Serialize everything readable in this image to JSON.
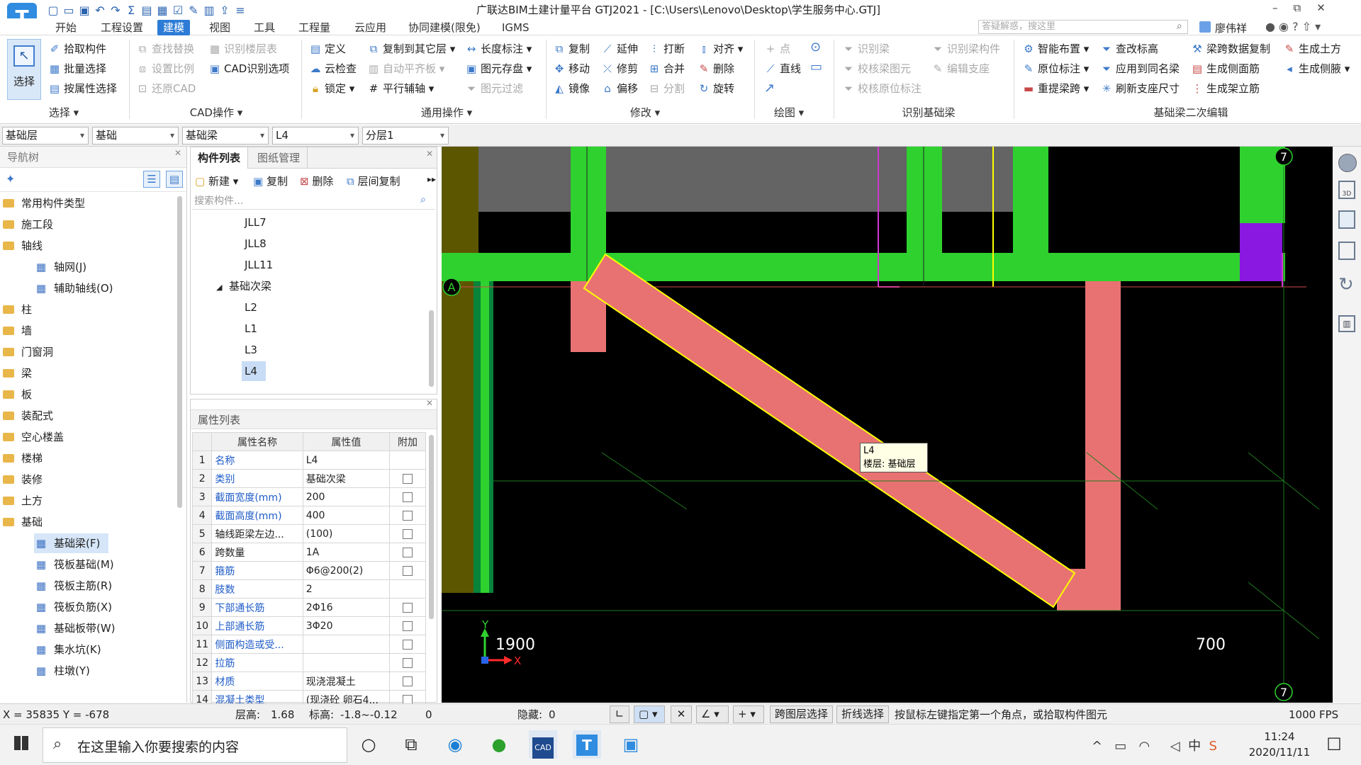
{
  "app": {
    "title": "广联达BIM土建计量平台 GTJ2021 - [C:\\Users\\Lenovo\\Desktop\\学生服务中心.GTJ]",
    "search_placeholder": "答疑解惑，搜这里",
    "user": "廖伟祥",
    "window_controls": [
      "–",
      "⧉",
      "✕"
    ]
  },
  "menu": [
    {
      "label": "开始",
      "active": false
    },
    {
      "label": "工程设置",
      "active": false
    },
    {
      "label": "建模",
      "active": true
    },
    {
      "label": "视图",
      "active": false
    },
    {
      "label": "工具",
      "active": false
    },
    {
      "label": "工程量",
      "active": false
    },
    {
      "label": "云应用",
      "active": false
    },
    {
      "label": "协同建模(限免)",
      "active": false
    },
    {
      "label": "IGMS",
      "active": false
    }
  ],
  "ribbon": {
    "select_big": "选择",
    "select_items": [
      "拾取构件",
      "批量选择",
      "按属性选择"
    ],
    "select_group": "选择",
    "cad_items": [
      "查找替换",
      "设置比例",
      "还原CAD",
      "识别楼层表",
      "CAD识别选项"
    ],
    "cad_group": "CAD操作",
    "general_items": [
      "定义",
      "云检查",
      "锁定",
      "复制到其它层",
      "自动平齐板",
      "平行辅轴",
      "长度标注",
      "图元存盘",
      "图元过滤"
    ],
    "general_group": "通用操作",
    "modify_items": [
      "复制",
      "移动",
      "镜像",
      "延伸",
      "修剪",
      "偏移",
      "打断",
      "合并",
      "分割",
      "对齐",
      "删除",
      "旋转"
    ],
    "modify_group": "修改",
    "draw_items": [
      "点",
      "直线"
    ],
    "draw_group": "绘图",
    "recog_items": [
      "识别梁",
      "校核梁图元",
      "校核原位标注",
      "识别梁构件",
      "编辑支座"
    ],
    "recog_group": "识别基础梁",
    "second_items": [
      "智能布置",
      "原位标注",
      "重提梁跨",
      "查改标高",
      "应用到同名梁",
      "刷新支座尺寸",
      "梁跨数据复制",
      "生成侧面筋",
      "生成架立筋",
      "生成土方",
      "生成侧腋"
    ],
    "second_group": "基础梁二次编辑"
  },
  "selectors": [
    "基础层",
    "基础",
    "基础梁",
    "L4",
    "分层1"
  ],
  "nav": {
    "header": "导航树",
    "items": [
      {
        "label": "常用构件类型",
        "type": "folder"
      },
      {
        "label": "施工段",
        "type": "folder"
      },
      {
        "label": "轴线",
        "type": "folder"
      },
      {
        "label": "轴网(J)",
        "type": "child"
      },
      {
        "label": "辅助轴线(O)",
        "type": "child"
      },
      {
        "label": "柱",
        "type": "folder"
      },
      {
        "label": "墙",
        "type": "folder"
      },
      {
        "label": "门窗洞",
        "type": "folder"
      },
      {
        "label": "梁",
        "type": "folder"
      },
      {
        "label": "板",
        "type": "folder"
      },
      {
        "label": "装配式",
        "type": "folder"
      },
      {
        "label": "空心楼盖",
        "type": "folder"
      },
      {
        "label": "楼梯",
        "type": "folder"
      },
      {
        "label": "装修",
        "type": "folder"
      },
      {
        "label": "土方",
        "type": "folder"
      },
      {
        "label": "基础",
        "type": "folder"
      },
      {
        "label": "基础梁(F)",
        "type": "child",
        "selected": true
      },
      {
        "label": "筏板基础(M)",
        "type": "child"
      },
      {
        "label": "筏板主筋(R)",
        "type": "child"
      },
      {
        "label": "筏板负筋(X)",
        "type": "child"
      },
      {
        "label": "基础板带(W)",
        "type": "child"
      },
      {
        "label": "集水坑(K)",
        "type": "child"
      },
      {
        "label": "柱墩(Y)",
        "type": "child"
      }
    ]
  },
  "components": {
    "tabs": [
      "构件列表",
      "图纸管理"
    ],
    "toolbar": [
      "新建",
      "复制",
      "删除",
      "层间复制"
    ],
    "search_placeholder": "搜索构件...",
    "items": [
      {
        "label": "JLL7",
        "indent": 2
      },
      {
        "label": "JLL8",
        "indent": 2
      },
      {
        "label": "JLL11",
        "indent": 2
      },
      {
        "label": "基础次梁",
        "indent": 1
      },
      {
        "label": "L2",
        "indent": 2
      },
      {
        "label": "L1",
        "indent": 2
      },
      {
        "label": "L3",
        "indent": 2
      },
      {
        "label": "L4",
        "indent": 2,
        "selected": true
      }
    ]
  },
  "properties": {
    "header": "属性列表",
    "columns": [
      "属性名称",
      "属性值",
      "附加"
    ],
    "rows": [
      {
        "n": "1",
        "name": "名称",
        "value": "L4",
        "blue": true,
        "check": false
      },
      {
        "n": "2",
        "name": "类别",
        "value": "基础次梁",
        "blue": true,
        "check": true
      },
      {
        "n": "3",
        "name": "截面宽度(mm)",
        "value": "200",
        "blue": true,
        "check": true
      },
      {
        "n": "4",
        "name": "截面高度(mm)",
        "value": "400",
        "blue": true,
        "check": true
      },
      {
        "n": "5",
        "name": "轴线距梁左边...",
        "value": "(100)",
        "blue": false,
        "check": true
      },
      {
        "n": "6",
        "name": "跨数量",
        "value": "1A",
        "blue": false,
        "check": true
      },
      {
        "n": "7",
        "name": "箍筋",
        "value": "Φ6@200(2)",
        "blue": true,
        "check": true
      },
      {
        "n": "8",
        "name": "肢数",
        "value": "2",
        "blue": true,
        "check": false
      },
      {
        "n": "9",
        "name": "下部通长筋",
        "value": "2Φ16",
        "blue": true,
        "check": true
      },
      {
        "n": "10",
        "name": "上部通长筋",
        "value": "3Φ20",
        "blue": true,
        "check": true
      },
      {
        "n": "11",
        "name": "侧面构造或受...",
        "value": "",
        "blue": true,
        "check": true
      },
      {
        "n": "12",
        "name": "拉筋",
        "value": "",
        "blue": true,
        "check": true
      },
      {
        "n": "13",
        "name": "材质",
        "value": "现浇混凝土",
        "blue": true,
        "check": true
      },
      {
        "n": "14",
        "name": "混凝土类型",
        "value": "(现浇砼 卵石4...",
        "blue": true,
        "check": true
      }
    ]
  },
  "canvas": {
    "axis_a": "A",
    "axis_7": "7",
    "dim_left": "1900",
    "dim_right": "700",
    "tooltip_name": "L4",
    "tooltip_floor": "楼层: 基础层",
    "ucs_y": "Y",
    "ucs_x": "X",
    "colors": {
      "beam_green": "#2fd12f",
      "beam_pink": "#e87272",
      "selected_outline": "#ffff00",
      "magenta": "#d236d2",
      "purple": "#8a18e0",
      "gray_slab": "#646464",
      "olive": "#5c5600"
    }
  },
  "status": {
    "coords": "X = 35835 Y = -678",
    "floor_height_label": "层高:",
    "floor_height": "1.68",
    "elev_label": "标高:",
    "elev": "-1.8~-0.12",
    "zero": "0",
    "hidden_label": "隐藏:",
    "hidden": "0",
    "btn_cross_floor": "跨图层选择",
    "btn_polyline": "折线选择",
    "hint": "按鼠标左键指定第一个角点，或拾取构件图元",
    "fps": "1000 FPS"
  },
  "taskbar": {
    "search_placeholder": "在这里输入你要搜索的内容",
    "time": "11:24",
    "date": "2020/11/11",
    "ime": "中"
  }
}
